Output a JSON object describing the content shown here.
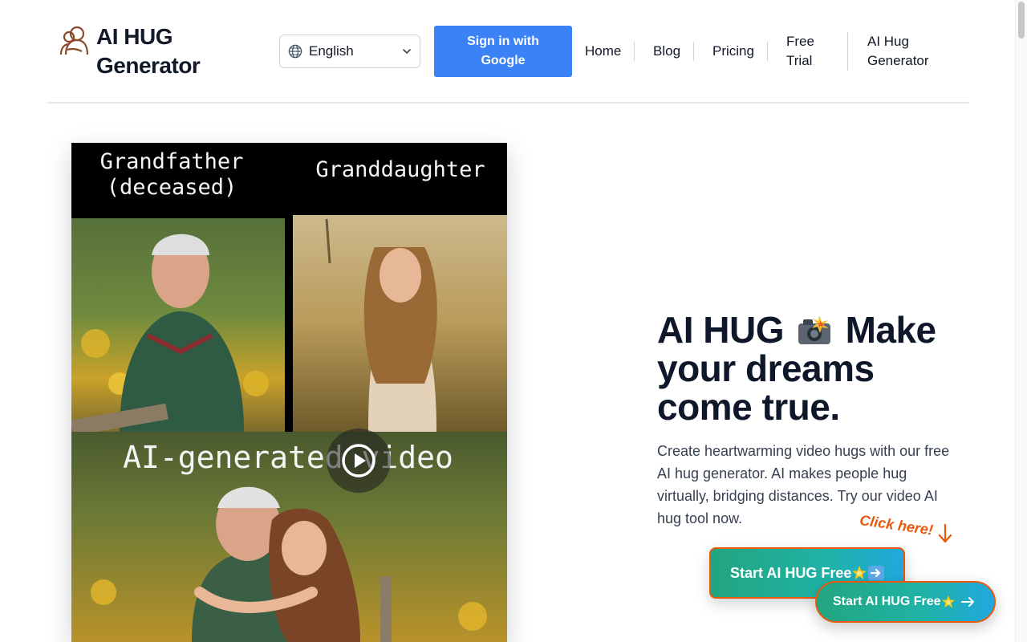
{
  "header": {
    "logo_text": "AI HUG Generator",
    "language": {
      "selected": "English",
      "icon": "globe-icon"
    },
    "signin_label": "Sign in with Google",
    "nav": [
      {
        "label": "Home"
      },
      {
        "label": "Blog"
      },
      {
        "label": "Pricing"
      },
      {
        "label": "Free Trial"
      },
      {
        "label": "AI Hug Generator"
      }
    ]
  },
  "media": {
    "caption_left": "Grandfather (deceased)",
    "caption_right": "Granddaughter",
    "caption_video": "AI-generated video"
  },
  "hero": {
    "headline_part1": "AI HUG",
    "headline_part2": "Make your dreams come true.",
    "description": "Create heartwarming video hugs with our free AI hug generator. AI makes people hug virtually, bridging distances. Try our video AI hug tool now.",
    "hint": "Click here!",
    "cta_label": "Start AI HUG Free",
    "cta_float_label": "Start AI HUG Free"
  },
  "colors": {
    "primary_button": "#3b82f6",
    "accent_orange": "#ea580c",
    "cta_gradient_start": "#22a57f",
    "cta_gradient_end": "#21a8e0"
  }
}
